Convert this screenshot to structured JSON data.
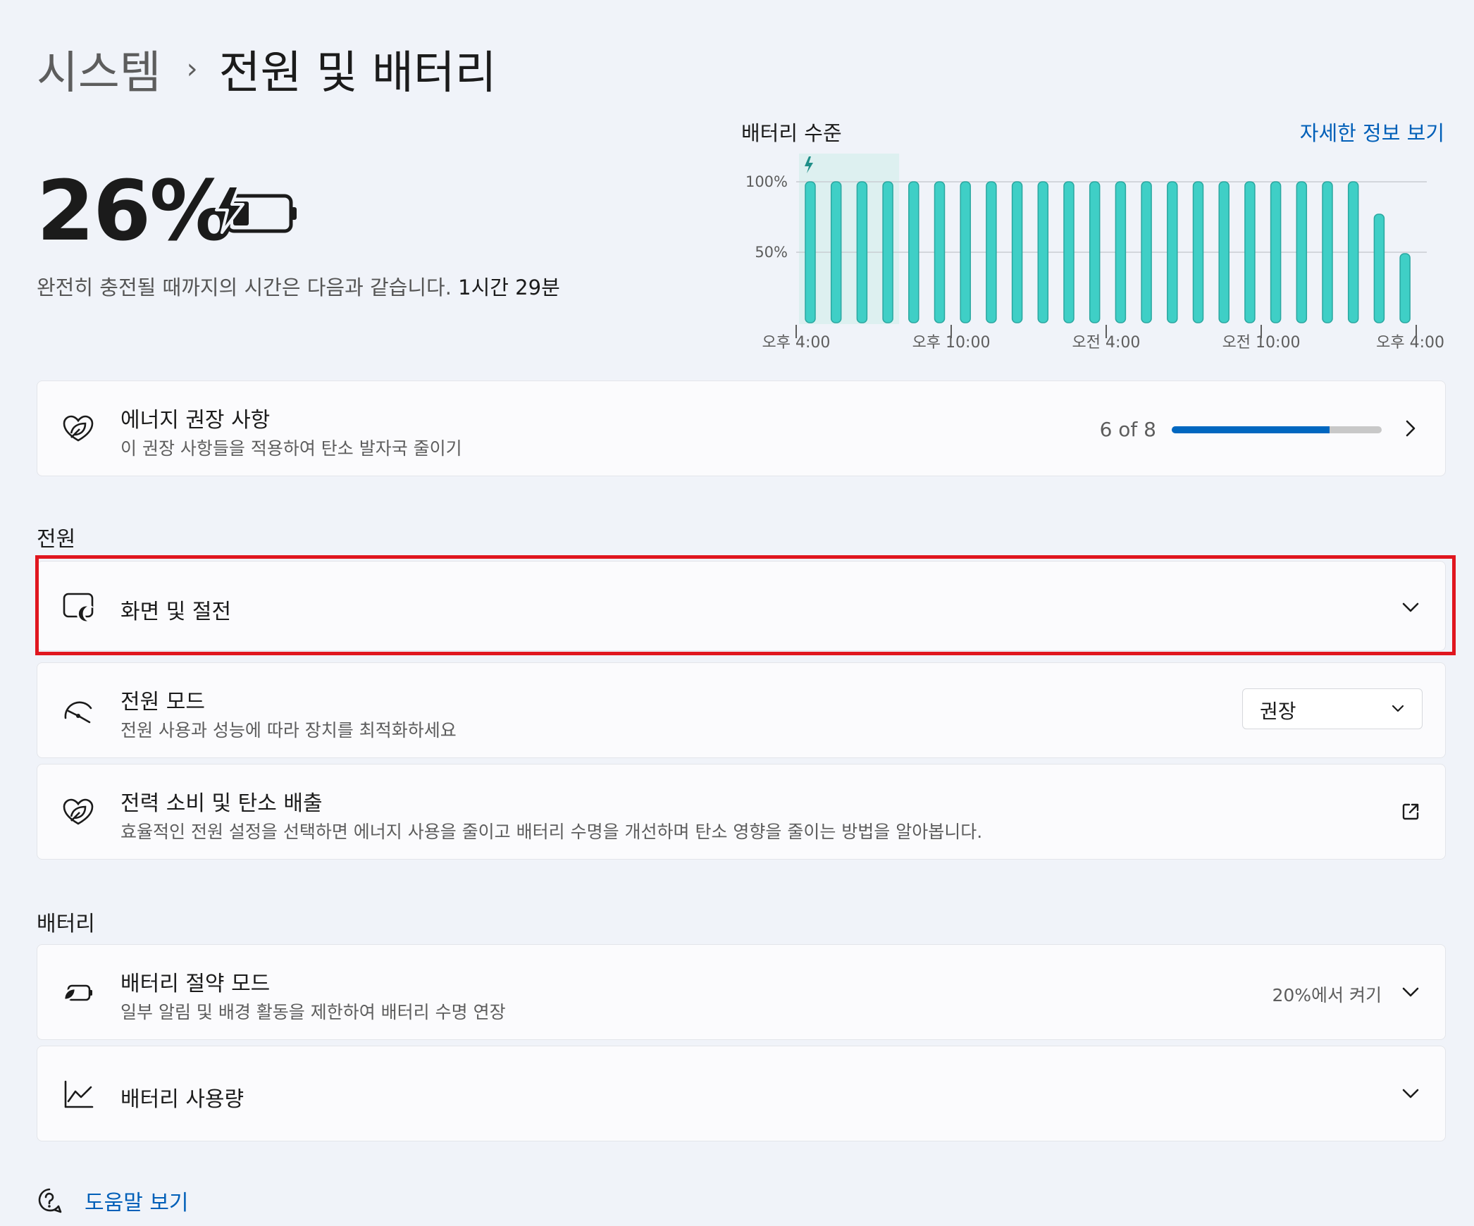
{
  "breadcrumb": {
    "parent": "시스템",
    "separator": "›",
    "current": "전원 및 배터리"
  },
  "battery": {
    "percent": "26%",
    "level": 0.26,
    "charging": true,
    "charge_text": "완전히 충전될 때까지의 시간은 다음과 같습니다.",
    "charge_time": "1시간 29분"
  },
  "chart": {
    "title": "배터리 수준",
    "link": "자세한 정보 보기"
  },
  "chart_data": {
    "type": "bar",
    "title": "배터리 수준",
    "y_tick_labels": [
      "100%",
      "50%"
    ],
    "ylim": [
      0,
      100
    ],
    "x_tick_labels": [
      "오후 4:00",
      "오후 10:00",
      "오전 4:00",
      "오전 10:00",
      "오후 4:00"
    ],
    "values": [
      100,
      100,
      100,
      100,
      100,
      100,
      100,
      100,
      100,
      100,
      100,
      100,
      100,
      100,
      100,
      100,
      100,
      100,
      100,
      100,
      100,
      100,
      77,
      49
    ],
    "charging_bars": [
      0,
      1,
      2,
      3
    ],
    "grid": true,
    "color": "#3fcfc6"
  },
  "energy": {
    "title": "에너지 권장 사항",
    "subtitle": "이 권장 사항들을 적용하여 탄소 발자국 줄이기",
    "progress_text": "6 of 8",
    "progress": 0.75
  },
  "sections": {
    "power": "전원",
    "battery": "배터리"
  },
  "screen_sleep": {
    "title": "화면 및 절전"
  },
  "power_mode": {
    "title": "전원 모드",
    "subtitle": "전원 사용과 성능에 따라 장치를 최적화하세요",
    "value": "권장"
  },
  "power_carbon": {
    "title": "전력 소비 및 탄소 배출",
    "subtitle": "효율적인 전원 설정을 선택하면 에너지 사용을 줄이고 배터리 수명을 개선하며 탄소 영향을 줄이는 방법을 알아봅니다."
  },
  "battery_saver": {
    "title": "배터리 절약 모드",
    "subtitle": "일부 알림 및 배경 활동을 제한하여 배터리 수명 연장",
    "value": "20%에서 켜기"
  },
  "battery_usage": {
    "title": "배터리 사용량"
  },
  "help": {
    "label": "도움말 보기"
  },
  "colors": {
    "accent": "#005fb8",
    "progress": "#0067c0",
    "bar": "#3fcfc6",
    "highlight": "#e0161f"
  }
}
